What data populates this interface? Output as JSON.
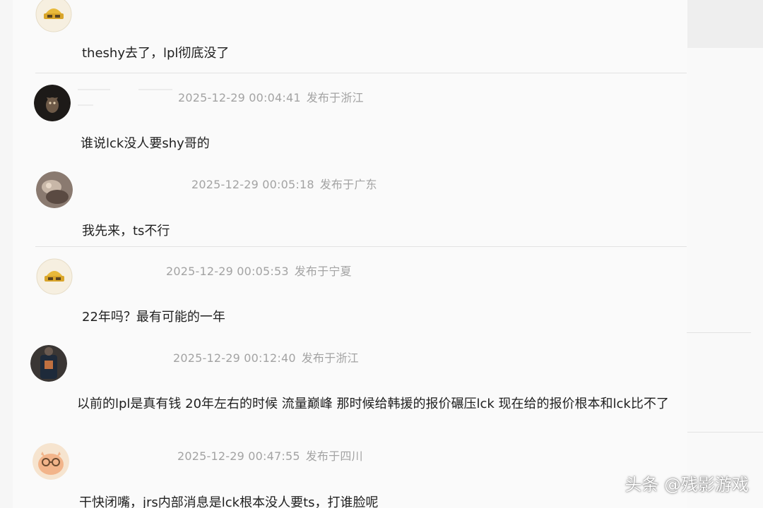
{
  "comments": [
    {
      "avatar": "gold-helmet-avatar",
      "time": "",
      "location": "",
      "text": "theshy去了，lpl彻底没了"
    },
    {
      "avatar": "dark-cat-avatar",
      "time": "2025-12-29 00:04:41",
      "location": "发布于浙江",
      "text": "谁说lck没人要shy哥的"
    },
    {
      "avatar": "photo-avatar",
      "time": "2025-12-29 00:05:18",
      "location": "发布于广东",
      "text": "我先来，ts不行"
    },
    {
      "avatar": "gold-helmet-avatar",
      "time": "2025-12-29 00:05:53",
      "location": "发布于宁夏",
      "text": "22年吗？最有可能的一年"
    },
    {
      "avatar": "dark-shirt-avatar",
      "time": "2025-12-29 00:12:40",
      "location": "发布于浙江",
      "text": "以前的lpl是真有钱 20年左右的时候 流量巅峰 那时候给韩援的报价碾压lck 现在给的报价根本和lck比不了"
    },
    {
      "avatar": "cartoon-glasses-avatar",
      "time": "2025-12-29 00:47:55",
      "location": "发布于四川",
      "text": "干快闭嘴，jrs内部消息是lck根本没人要ts，打谁脸呢"
    }
  ],
  "watermark": "头条 @残影游戏"
}
